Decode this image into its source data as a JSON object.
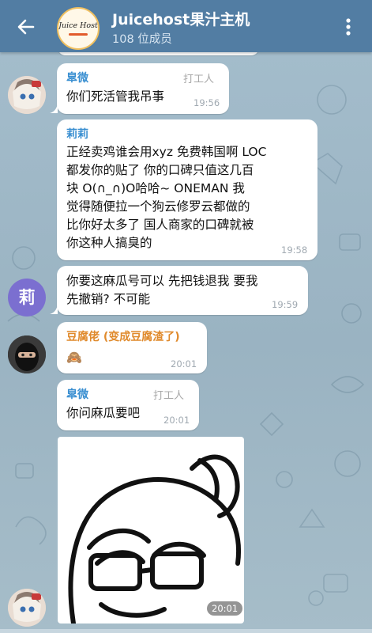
{
  "header": {
    "title": "Juicehost果汁主机",
    "subtitle": "108 位成员",
    "avatar_logo": "Juice Host"
  },
  "messages": [
    {
      "sender": "皐微",
      "sender_color": "#3a8fd1",
      "badge": "打工人",
      "text": "你们死活管我吊事",
      "time": "19:56"
    },
    {
      "sender": "莉莉",
      "sender_color": "#3a8fd1",
      "lines": [
        "正经卖鸡谁会用xyz 免费韩国啊  LOC",
        "都发你的贴了 你的口碑只值这几百",
        "块 O(∩_∩)O哈哈~   ONEMAN 我",
        "觉得随便拉一个狗云修罗云都做的",
        "比你好太多了 国人商家的口碑就被",
        "你这种人搞臭的"
      ],
      "time": "19:58"
    },
    {
      "avatar_letter": "莉",
      "lines": [
        "你要这麻瓜号可以 先把钱退我 要我",
        "先撤销? 不可能"
      ],
      "time": "19:59"
    },
    {
      "sender": "豆腐佬 (变成豆腐渣了)",
      "sender_color": "#e08a2c",
      "text": "🙈",
      "time": "20:01"
    },
    {
      "sender": "皐微",
      "sender_color": "#3a8fd1",
      "badge": "打工人",
      "text": "你问麻瓜要吧",
      "time": "20:01"
    },
    {
      "sticker": "meme-sticker",
      "time": "20:01"
    }
  ],
  "colors": {
    "header": "#527da3",
    "background": "#a3bccb",
    "bubble": "#ffffff",
    "letter_avatar": "#7b6fd0"
  }
}
